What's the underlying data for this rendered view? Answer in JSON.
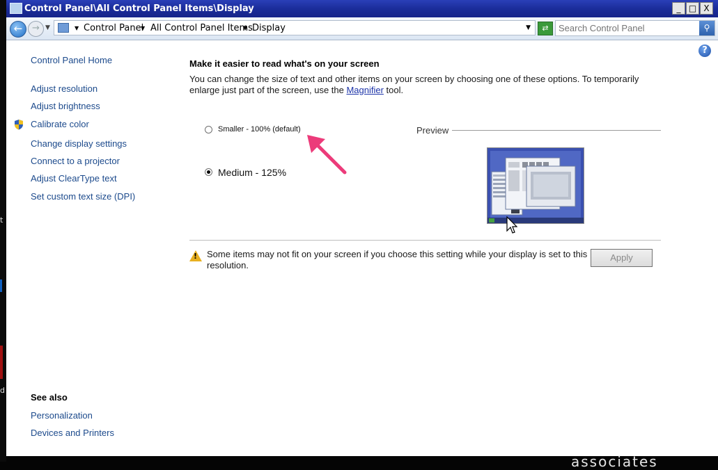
{
  "window": {
    "title": "Control Panel\\All Control Panel Items\\Display",
    "controls": {
      "minimize": "_",
      "maximize": "□",
      "close": "X"
    }
  },
  "address_bar": {
    "breadcrumbs": [
      "Control Panel",
      "All Control Panel Items",
      "Display"
    ],
    "search_placeholder": "Search Control Panel"
  },
  "sidebar": {
    "home": "Control Panel Home",
    "items": [
      {
        "label": "Adjust resolution"
      },
      {
        "label": "Adjust brightness"
      },
      {
        "label": "Calibrate color",
        "icon": "shield-icon"
      },
      {
        "label": "Change display settings"
      },
      {
        "label": "Connect to a projector"
      },
      {
        "label": "Adjust ClearType text"
      },
      {
        "label": "Set custom text size (DPI)"
      }
    ],
    "see_also": {
      "heading": "See also",
      "links": [
        "Personalization",
        "Devices and Printers"
      ]
    }
  },
  "main": {
    "heading": "Make it easier to read what's on your screen",
    "description_before": "You can change the size of text and other items on your screen by choosing one of these options. To temporarily enlarge just part of the screen, use the ",
    "magnifier_link": "Magnifier",
    "description_after": " tool.",
    "options": [
      {
        "label": "Smaller - 100% (default)",
        "selected": false
      },
      {
        "label": "Medium - 125%",
        "selected": true
      }
    ],
    "preview_label": "Preview",
    "warning": "Some items may not fit on your screen if you choose this setting while your display is set to this resolution.",
    "apply_label": "Apply",
    "apply_enabled": false
  },
  "colors": {
    "titlebar": "#1b2d9a",
    "link": "#1c4a8c",
    "annotation_arrow": "#ec3b7a"
  },
  "overlay_text": {
    "left_edge_1": "t",
    "left_edge_2": "d",
    "bottom_right": "associates"
  }
}
